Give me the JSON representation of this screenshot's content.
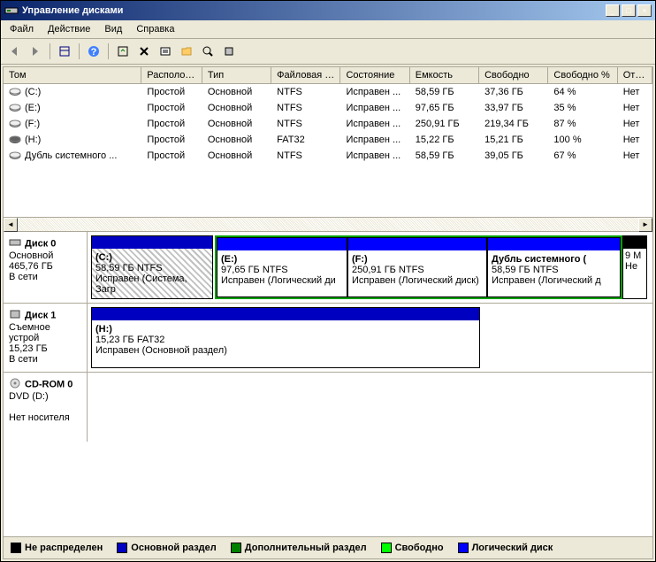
{
  "window": {
    "title": "Управление дисками"
  },
  "menu": {
    "file": "Файл",
    "action": "Действие",
    "view": "Вид",
    "help": "Справка"
  },
  "columns": {
    "volume": "Том",
    "layout": "Располож...",
    "type": "Тип",
    "fs": "Файловая с...",
    "status": "Состояние",
    "capacity": "Емкость",
    "free": "Свободно",
    "pfree": "Свободно %",
    "fail": "Отказо"
  },
  "volumes": [
    {
      "name": "(C:)",
      "layout": "Простой",
      "type": "Основной",
      "fs": "NTFS",
      "status": "Исправен ...",
      "cap": "58,59 ГБ",
      "free": "37,36 ГБ",
      "pfree": "64 %",
      "fail": "Нет"
    },
    {
      "name": "(E:)",
      "layout": "Простой",
      "type": "Основной",
      "fs": "NTFS",
      "status": "Исправен ...",
      "cap": "97,65 ГБ",
      "free": "33,97 ГБ",
      "pfree": "35 %",
      "fail": "Нет"
    },
    {
      "name": "(F:)",
      "layout": "Простой",
      "type": "Основной",
      "fs": "NTFS",
      "status": "Исправен ...",
      "cap": "250,91 ГБ",
      "free": "219,34 ГБ",
      "pfree": "87 %",
      "fail": "Нет"
    },
    {
      "name": "(H:)",
      "layout": "Простой",
      "type": "Основной",
      "fs": "FAT32",
      "status": "Исправен ...",
      "cap": "15,22 ГБ",
      "free": "15,21 ГБ",
      "pfree": "100 %",
      "fail": "Нет"
    },
    {
      "name": "Дубль системного ...",
      "layout": "Простой",
      "type": "Основной",
      "fs": "NTFS",
      "status": "Исправен ...",
      "cap": "58,59 ГБ",
      "free": "39,05 ГБ",
      "pfree": "67 %",
      "fail": "Нет"
    }
  ],
  "disks": {
    "disk0": {
      "name": "Диск 0",
      "type": "Основной",
      "size": "465,76 ГБ",
      "status": "В сети"
    },
    "disk1": {
      "name": "Диск 1",
      "type": "Съемное устрой",
      "size": "15,23 ГБ",
      "status": "В сети"
    },
    "cdrom": {
      "name": "CD-ROM 0",
      "type": "DVD (D:)",
      "status": "Нет носителя"
    }
  },
  "parts": {
    "c": {
      "label": "(C:)",
      "info": "58,59 ГБ NTFS",
      "status": "Исправен (Система, Загр"
    },
    "e": {
      "label": "(E:)",
      "info": "97,65 ГБ NTFS",
      "status": "Исправен (Логический ди"
    },
    "f": {
      "label": "(F:)",
      "info": "250,91 ГБ NTFS",
      "status": "Исправен (Логический диск)"
    },
    "dup": {
      "label": "Дубль системного  (",
      "info": "58,59 ГБ NTFS",
      "status": "Исправен (Логический д"
    },
    "unalloc": {
      "label": "",
      "info": "9 М",
      "status": "Не"
    },
    "h": {
      "label": "(H:)",
      "info": "15,23 ГБ FAT32",
      "status": "Исправен (Основной раздел)"
    }
  },
  "legend": {
    "unalloc": "Не распределен",
    "primary": "Основной раздел",
    "extended": "Дополнительный раздел",
    "free": "Свободно",
    "logical": "Логический диск"
  }
}
